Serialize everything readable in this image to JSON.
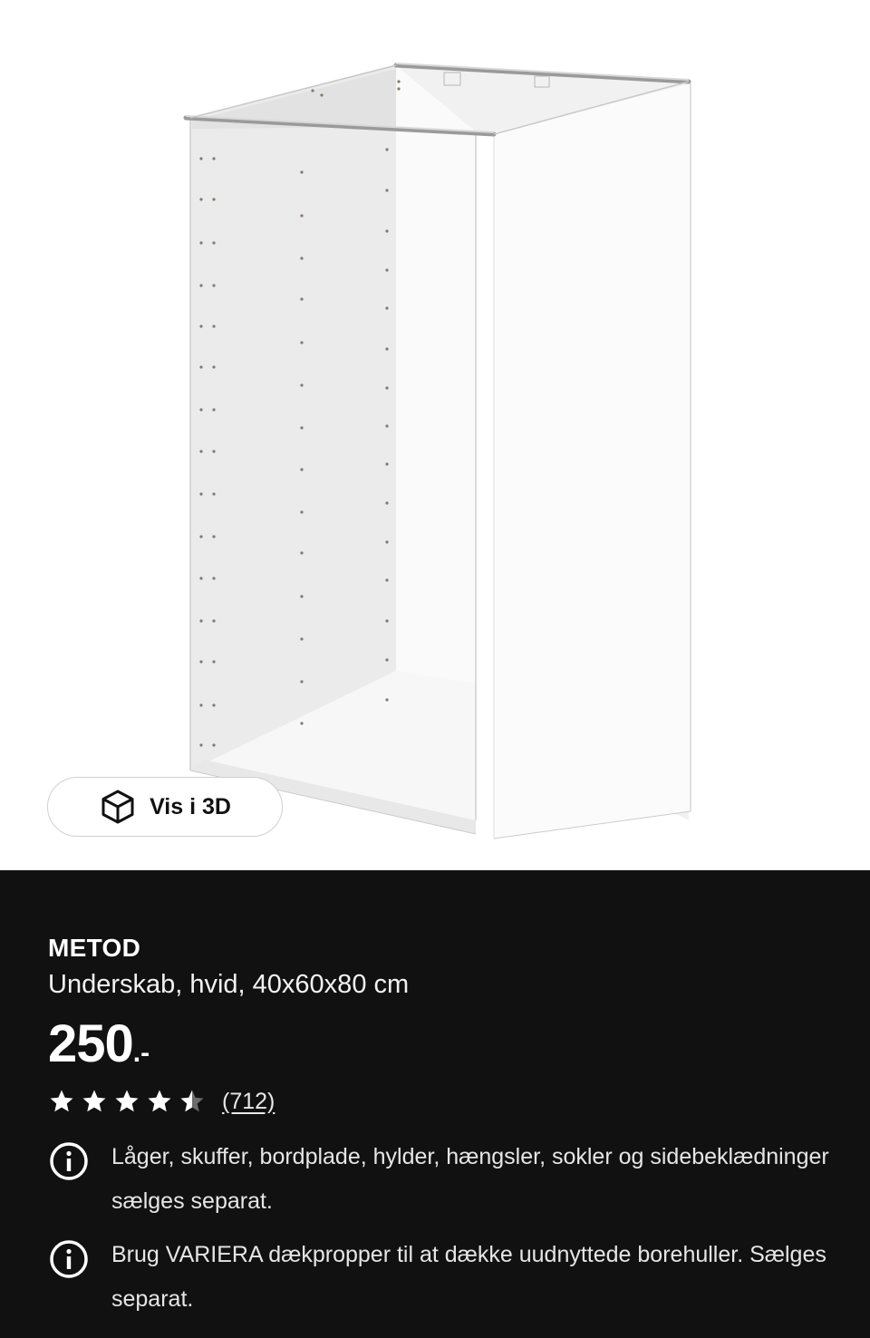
{
  "hero": {
    "image_alt": "White METOD base cabinet frame",
    "view_3d_label": "Vis i 3D",
    "view_3d_icon": "cube-icon"
  },
  "product": {
    "name": "METOD",
    "description": "Underskab, hvid, 40x60x80 cm",
    "price_integer": "250",
    "price_decimal": ".-",
    "rating": 4.5,
    "rating_max": 5,
    "review_count": "(712)"
  },
  "notes": [
    {
      "icon": "info-icon",
      "text": "Låger, skuffer, bordplade, hylder, hængsler, sokler og sidebeklædninger sælges separat."
    },
    {
      "icon": "info-icon",
      "text": "Brug VARIERA dækpropper til at dække uudnyttede borehuller. Sælges separat."
    }
  ],
  "colors": {
    "background": "#111111",
    "text": "#ffffff",
    "hero_background": "#ffffff"
  }
}
